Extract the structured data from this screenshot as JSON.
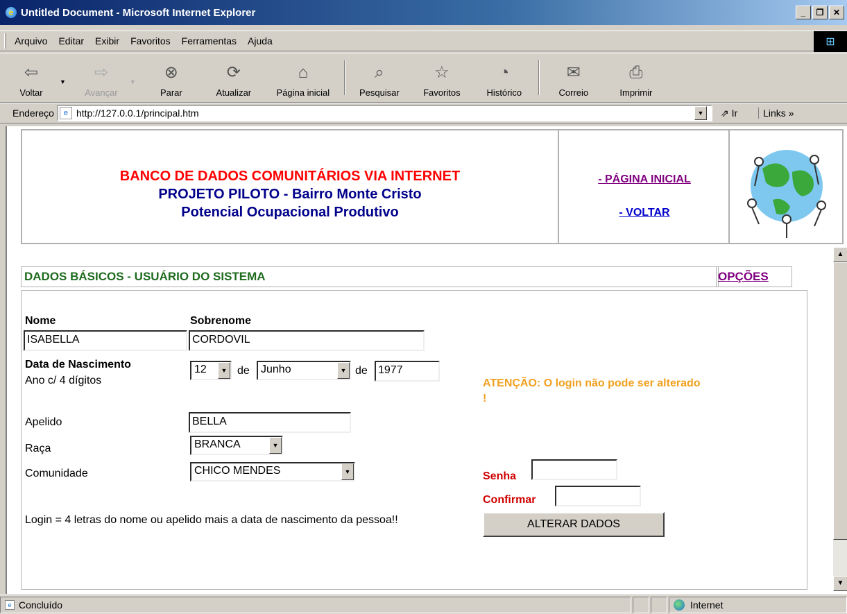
{
  "window": {
    "title": "Untitled Document - Microsoft Internet Explorer"
  },
  "menu": [
    "Arquivo",
    "Editar",
    "Exibir",
    "Favoritos",
    "Ferramentas",
    "Ajuda"
  ],
  "toolbar": [
    {
      "label": "Voltar",
      "icon": "back-arrow-icon",
      "enabled": true
    },
    {
      "label": "Avançar",
      "icon": "forward-arrow-icon",
      "enabled": false
    },
    {
      "label": "Parar",
      "icon": "stop-icon",
      "enabled": true
    },
    {
      "label": "Atualizar",
      "icon": "refresh-icon",
      "enabled": true
    },
    {
      "label": "Página inicial",
      "icon": "home-icon",
      "enabled": true
    },
    {
      "label": "Pesquisar",
      "icon": "search-icon",
      "enabled": true
    },
    {
      "label": "Favoritos",
      "icon": "favorites-icon",
      "enabled": true
    },
    {
      "label": "Histórico",
      "icon": "history-icon",
      "enabled": true
    },
    {
      "label": "Correio",
      "icon": "mail-icon",
      "enabled": true
    },
    {
      "label": "Imprimir",
      "icon": "print-icon",
      "enabled": true
    }
  ],
  "address": {
    "label": "Endereço",
    "url": "http://127.0.0.1/principal.htm",
    "go": "Ir",
    "links": "Links"
  },
  "header": {
    "line1": "BANCO DE DADOS COMUNITÁRIOS VIA INTERNET",
    "line2": "PROJETO PILOTO - Bairro Monte Cristo",
    "line3": "Potencial Ocupacional Produtivo",
    "link_home": "- PÁGINA INICIAL",
    "link_back": "- VOLTAR"
  },
  "section": {
    "title": "DADOS BÁSICOS - USUÁRIO DO SISTEMA",
    "options": "OPÇÕES"
  },
  "form": {
    "nome_label": "Nome",
    "nome_value": "ISABELLA",
    "sobrenome_label": "Sobrenome",
    "sobrenome_value": "CORDOVIL",
    "nasc_label": "Data de Nascimento",
    "nasc_hint": "Ano c/ 4 dígitos",
    "day": "12",
    "de1": "de",
    "month": "Junho",
    "de2": "de",
    "year": "1977",
    "apelido_label": "Apelido",
    "apelido_value": "BELLA",
    "raca_label": "Raça",
    "raca_value": "BRANCA",
    "comunidade_label": "Comunidade",
    "comunidade_value": "CHICO MENDES",
    "login_note": "Login = 4 letras do nome ou apelido mais a data de nascimento da pessoa!!",
    "warning": "ATENÇÃO: O login não pode ser alterado !",
    "senha_label": "Senha",
    "confirmar_label": "Confirmar",
    "submit": "ALTERAR DADOS"
  },
  "status": {
    "text": "Concluído",
    "zone": "Internet"
  }
}
